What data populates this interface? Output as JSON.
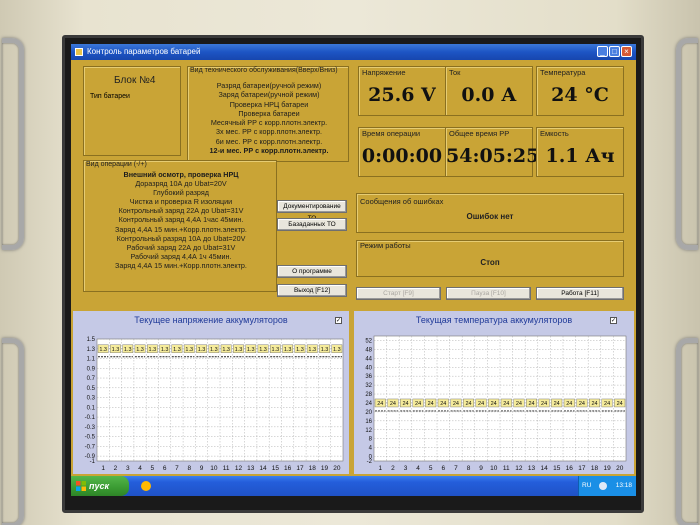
{
  "window": {
    "title": "Контроль параметров батарей"
  },
  "block": {
    "title": "Блок №4",
    "battery_type_label": "Тип батареи"
  },
  "maintenance": {
    "header": "Вид технического обслуживания(Вверх/Вниз)",
    "items": [
      "Разряд батареи(ручной режим)",
      "Заряд батареи(ручной режим)",
      "Проверка НРЦ батареи",
      "Проверка батареи",
      "Месячный РР с корр.плотн.электр.",
      "3х мес. РР с корр.плотн.электр.",
      "6и мес. РР с корр.плотн.электр.",
      "12-и мес. РР с корр.плотн.электр."
    ]
  },
  "operations": {
    "header": "Вид операции (-/+)",
    "items": [
      "Внешний осмотр, проверка НРЦ",
      "Доразряд 10А до Ubat=20V",
      "Глубокий разряд",
      "Чистка и проверка R изоляции",
      "Контрольный заряд 22А до Ubat=31V",
      "Контрольный заряд 4,4А 1час 45мин.",
      "Заряд 4,4А 15 мин.+Корр.плотн.электр.",
      "Контрольный разряд 10А до Ubat=20V",
      "Рабочий заряд 22А до Ubat=31V",
      "Рабочий заряд 4,4А 1ч 45мин.",
      "Заряд 4,4А 15 мин.+Корр.плотн.электр."
    ]
  },
  "buttons": {
    "doc_to": "Документирование ТО",
    "db_to": "Базаданных ТО",
    "about": "О программе",
    "exit": "Выход [F12]",
    "start": "Старт [F9]",
    "pause": "Пауза [F10]",
    "work": "Работа [F11]"
  },
  "metrics": {
    "voltage": {
      "label": "Напряжение",
      "value": "25.6 V"
    },
    "current": {
      "label": "Ток",
      "value": "0.0 А"
    },
    "temperature": {
      "label": "Температура",
      "value": "24 °С"
    },
    "op_time": {
      "label": "Время операции",
      "value": "0:00:00"
    },
    "total_time": {
      "label": "Общее время РР",
      "value": "54:05:25"
    },
    "capacity": {
      "label": "Емкость",
      "value": "1.1 Ач"
    }
  },
  "errors": {
    "label": "Сообщения об ошибках",
    "value": "Ошибок нет"
  },
  "mode": {
    "label": "Режим работы",
    "value": "Стоп"
  },
  "taskbar": {
    "start_label": "пуск",
    "lang": "RU",
    "clock": "13:18"
  },
  "chart_data": [
    {
      "type": "bar",
      "title": "Текущее напряжение аккумуляторов",
      "categories": [
        "1",
        "2",
        "3",
        "4",
        "5",
        "6",
        "7",
        "8",
        "9",
        "10",
        "11",
        "12",
        "13",
        "14",
        "15",
        "16",
        "17",
        "18",
        "19",
        "20"
      ],
      "series": [
        {
          "values": [
            1.3,
            1.3,
            1.3,
            1.3,
            1.3,
            1.3,
            1.3,
            1.3,
            1.3,
            1.3,
            1.3,
            1.3,
            1.3,
            1.3,
            1.3,
            1.3,
            1.3,
            1.3,
            1.3,
            1.3
          ]
        }
      ],
      "ylim": [
        -1,
        1.5
      ],
      "yticks": [
        "1.5",
        "1.3",
        "1.1",
        "0.9",
        "0.7",
        "0.5",
        "0.3",
        "0.1",
        "-0.1",
        "-0.3",
        "-0.5",
        "-0.7",
        "-0.9",
        "-1"
      ],
      "data_labels": "1.3",
      "grid": true
    },
    {
      "type": "bar",
      "title": "Текущая температура аккумуляторов",
      "categories": [
        "1",
        "2",
        "3",
        "4",
        "5",
        "6",
        "7",
        "8",
        "9",
        "10",
        "11",
        "12",
        "13",
        "14",
        "15",
        "16",
        "17",
        "18",
        "19",
        "20"
      ],
      "series": [
        {
          "values": [
            24,
            24,
            24,
            24,
            24,
            24,
            24,
            24,
            24,
            24,
            24,
            24,
            24,
            24,
            24,
            24,
            24,
            24,
            24,
            24
          ]
        }
      ],
      "ylim": [
        -2,
        54
      ],
      "yticks": [
        "52",
        "48",
        "44",
        "40",
        "36",
        "32",
        "28",
        "24",
        "20",
        "16",
        "12",
        "8",
        "4",
        "0",
        "-2"
      ],
      "data_labels": "24",
      "grid": true
    }
  ]
}
